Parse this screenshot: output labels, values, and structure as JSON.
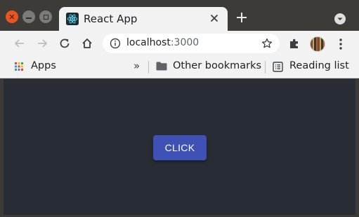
{
  "window": {
    "controls": [
      "close",
      "minimize",
      "maximize"
    ]
  },
  "tab": {
    "title": "React App",
    "favicon": "react-logo-icon"
  },
  "toolbar": {
    "url_host": "localhost",
    "url_port": ":3000",
    "icons": [
      "back-arrow-icon",
      "forward-arrow-icon",
      "reload-icon",
      "home-icon",
      "info-icon",
      "star-icon",
      "extensions-puzzle-icon",
      "profile-avatar",
      "kebab-menu-icon"
    ]
  },
  "bookmarks": {
    "apps_label": "Apps",
    "overflow_label": "»",
    "other_bookmarks_label": "Other bookmarks",
    "reading_list_label": "Reading list"
  },
  "content": {
    "button_label": "CLICK"
  },
  "colors": {
    "titlebar": "#3c3b37",
    "chrome": "#f2f2f2",
    "page_background": "#282c34",
    "button": "#3f51b5",
    "close_button": "#e95420"
  }
}
